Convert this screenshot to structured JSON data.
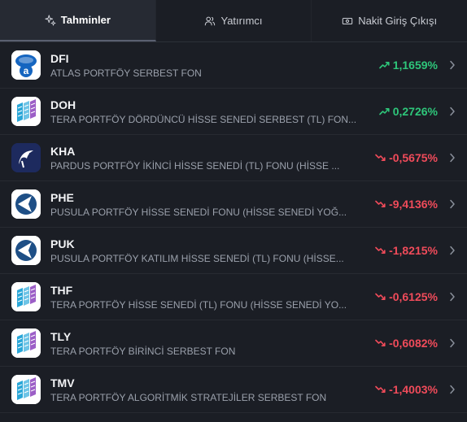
{
  "tabs": [
    {
      "label": "Tahminler",
      "icon": "sparkle-icon",
      "active": true
    },
    {
      "label": "Yatırımcı",
      "icon": "users-icon",
      "active": false
    },
    {
      "label": "Nakit Giriş Çıkışı",
      "icon": "cash-icon",
      "active": false
    }
  ],
  "colors": {
    "up": "#2ec67a",
    "down": "#f04b5a"
  },
  "funds": [
    {
      "code": "DFI",
      "name": "ATLAS PORTFÖY SERBEST FON",
      "change": "1,1659%",
      "direction": "up",
      "logo": "atlas"
    },
    {
      "code": "DOH",
      "name": "TERA PORTFÖY DÖRDÜNCÜ HİSSE SENEDİ SERBEST (TL) FON...",
      "change": "0,2726%",
      "direction": "up",
      "logo": "tera"
    },
    {
      "code": "KHA",
      "name": "PARDUS PORTFÖY İKİNCİ HİSSE SENEDİ (TL) FONU (HİSSE ...",
      "change": "-0,5675%",
      "direction": "down",
      "logo": "pardus"
    },
    {
      "code": "PHE",
      "name": "PUSULA PORTFÖY HİSSE SENEDİ FONU (HİSSE SENEDİ YOĞ...",
      "change": "-9,4136%",
      "direction": "down",
      "logo": "pusula"
    },
    {
      "code": "PUK",
      "name": "PUSULA PORTFÖY KATILIM HİSSE SENEDİ (TL) FONU (HİSSE...",
      "change": "-1,8215%",
      "direction": "down",
      "logo": "pusula"
    },
    {
      "code": "THF",
      "name": "TERA PORTFÖY HİSSE SENEDİ (TL) FONU (HİSSE SENEDİ YO...",
      "change": "-0,6125%",
      "direction": "down",
      "logo": "tera"
    },
    {
      "code": "TLY",
      "name": "TERA PORTFÖY BİRİNCİ SERBEST FON",
      "change": "-0,6082%",
      "direction": "down",
      "logo": "tera"
    },
    {
      "code": "TMV",
      "name": "TERA PORTFÖY ALGORİTMİK STRATEJİLER SERBEST FON",
      "change": "-1,4003%",
      "direction": "down",
      "logo": "tera"
    }
  ]
}
